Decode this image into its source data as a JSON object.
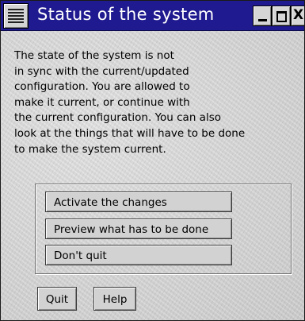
{
  "window": {
    "title": "Status of the system",
    "controls": {
      "minimize_icon": "minimize-icon",
      "maximize_icon": "maximize-icon",
      "close_glyph": "X"
    },
    "title_bar_color": "#1f1a8f"
  },
  "message": {
    "lines": [
      "The state of the system is not",
      "in sync with the current/updated",
      "configuration. You are allowed to",
      "make it current, or continue with",
      "the current configuration. You can also",
      "look at the things that will have to be done",
      "to make the system current."
    ]
  },
  "options": [
    {
      "label": "Activate the changes"
    },
    {
      "label": "Preview what has to be done"
    },
    {
      "label": "Don't quit"
    }
  ],
  "buttons": {
    "quit": "Quit",
    "help": "Help"
  }
}
